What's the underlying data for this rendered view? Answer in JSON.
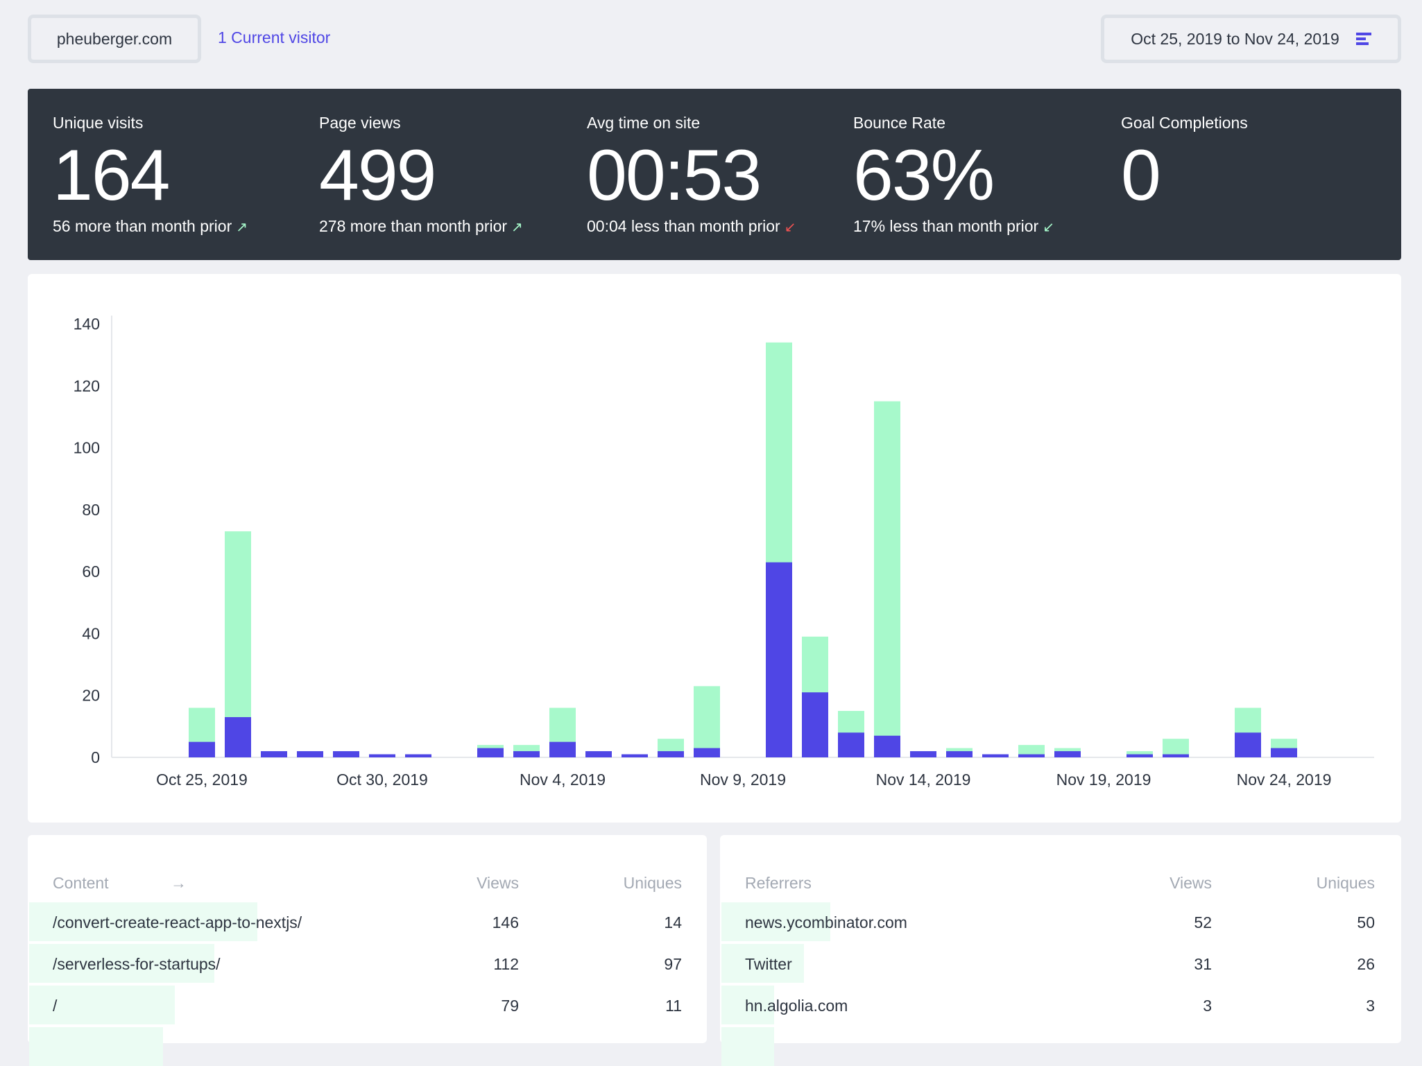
{
  "header": {
    "site": "pheuberger.com",
    "current_visitors": "1 Current visitor",
    "date_range": "Oct 25, 2019 to Nov 24, 2019",
    "date_menu_icon": "bars-icon"
  },
  "colors": {
    "accent": "#4f46e5",
    "views": "#a7f9cb",
    "uniques": "#4f46e5",
    "panel": "#2f363f",
    "up": "#a7f9cb",
    "down_bad": "#f05252"
  },
  "stats": [
    {
      "label": "Unique visits",
      "value": "164",
      "comparison": "56 more than month prior",
      "trend": "↗",
      "trend_color": "#a7f9cb"
    },
    {
      "label": "Page views",
      "value": "499",
      "comparison": "278 more than month prior",
      "trend": "↗",
      "trend_color": "#a7f9cb"
    },
    {
      "label": "Avg time on site",
      "value": "00:53",
      "comparison": "00:04 less than month prior",
      "trend": "↙",
      "trend_color": "#f05252"
    },
    {
      "label": "Bounce Rate",
      "value": "63%",
      "comparison": "17% less than month prior",
      "trend": "↙",
      "trend_color": "#a7f9cb"
    },
    {
      "label": "Goal Completions",
      "value": "0",
      "comparison": "",
      "trend": "",
      "trend_color": ""
    }
  ],
  "chart_data": {
    "type": "bar",
    "stacked": true,
    "ylim": [
      0,
      140
    ],
    "yticks": [
      "0",
      "20",
      "40",
      "60",
      "80",
      "100",
      "120",
      "140"
    ],
    "xtick_labels": [
      "Oct 25, 2019",
      "Oct 30, 2019",
      "Nov 4, 2019",
      "Nov 9, 2019",
      "Nov 14, 2019",
      "Nov 19, 2019",
      "Nov 24, 2019"
    ],
    "categories": [
      "Oct 23",
      "Oct 24",
      "Oct 25",
      "Oct 26",
      "Oct 27",
      "Oct 28",
      "Oct 29",
      "Oct 30",
      "Oct 31",
      "Nov 1",
      "Nov 2",
      "Nov 3",
      "Nov 4",
      "Nov 5",
      "Nov 6",
      "Nov 7",
      "Nov 8",
      "Nov 9",
      "Nov 10",
      "Nov 11",
      "Nov 12",
      "Nov 13",
      "Nov 14",
      "Nov 15",
      "Nov 16",
      "Nov 17",
      "Nov 18",
      "Nov 19",
      "Nov 20",
      "Nov 21",
      "Nov 22",
      "Nov 23",
      "Nov 24",
      "Nov 25",
      "Nov 26"
    ],
    "series": [
      {
        "key": "uniques",
        "color": "#4f46e5",
        "values": [
          0,
          0,
          5,
          13,
          2,
          2,
          2,
          1,
          1,
          0,
          3,
          2,
          5,
          2,
          1,
          2,
          3,
          0,
          63,
          21,
          8,
          7,
          2,
          2,
          1,
          1,
          2,
          0,
          1,
          1,
          0,
          8,
          3,
          0,
          0
        ]
      },
      {
        "key": "views",
        "color": "#a7f9cb",
        "values": [
          0,
          0,
          16,
          73,
          2,
          2,
          2,
          1,
          1,
          0,
          4,
          4,
          16,
          2,
          1,
          6,
          23,
          0,
          134,
          39,
          15,
          115,
          2,
          3,
          1,
          4,
          3,
          0,
          2,
          6,
          0,
          16,
          6,
          0,
          0
        ]
      }
    ],
    "grid": false
  },
  "content": {
    "header": "Content",
    "header_icon": "arrow-right-icon",
    "views_label": "Views",
    "uniques_label": "Uniques",
    "rows": [
      {
        "name": "/convert-create-react-app-to-nextjs/",
        "views": "146",
        "uniques": "14",
        "fill_pct": 33.6
      },
      {
        "name": "/serverless-for-startups/",
        "views": "112",
        "uniques": "97",
        "fill_pct": 27.3
      },
      {
        "name": "/",
        "views": "79",
        "uniques": "11",
        "fill_pct": 21.4
      },
      {
        "fill_pct": 19.7
      }
    ]
  },
  "referrers": {
    "header": "Referrers",
    "views_label": "Views",
    "uniques_label": "Uniques",
    "rows": [
      {
        "name": "news.ycombinator.com",
        "views": "52",
        "uniques": "50",
        "fill_pct": 16
      },
      {
        "name": "Twitter",
        "views": "31",
        "uniques": "26",
        "fill_pct": 12.1
      },
      {
        "name": "hn.algolia.com",
        "views": "3",
        "uniques": "3",
        "fill_pct": 7.7
      },
      {
        "fill_pct": 7.7
      }
    ]
  }
}
